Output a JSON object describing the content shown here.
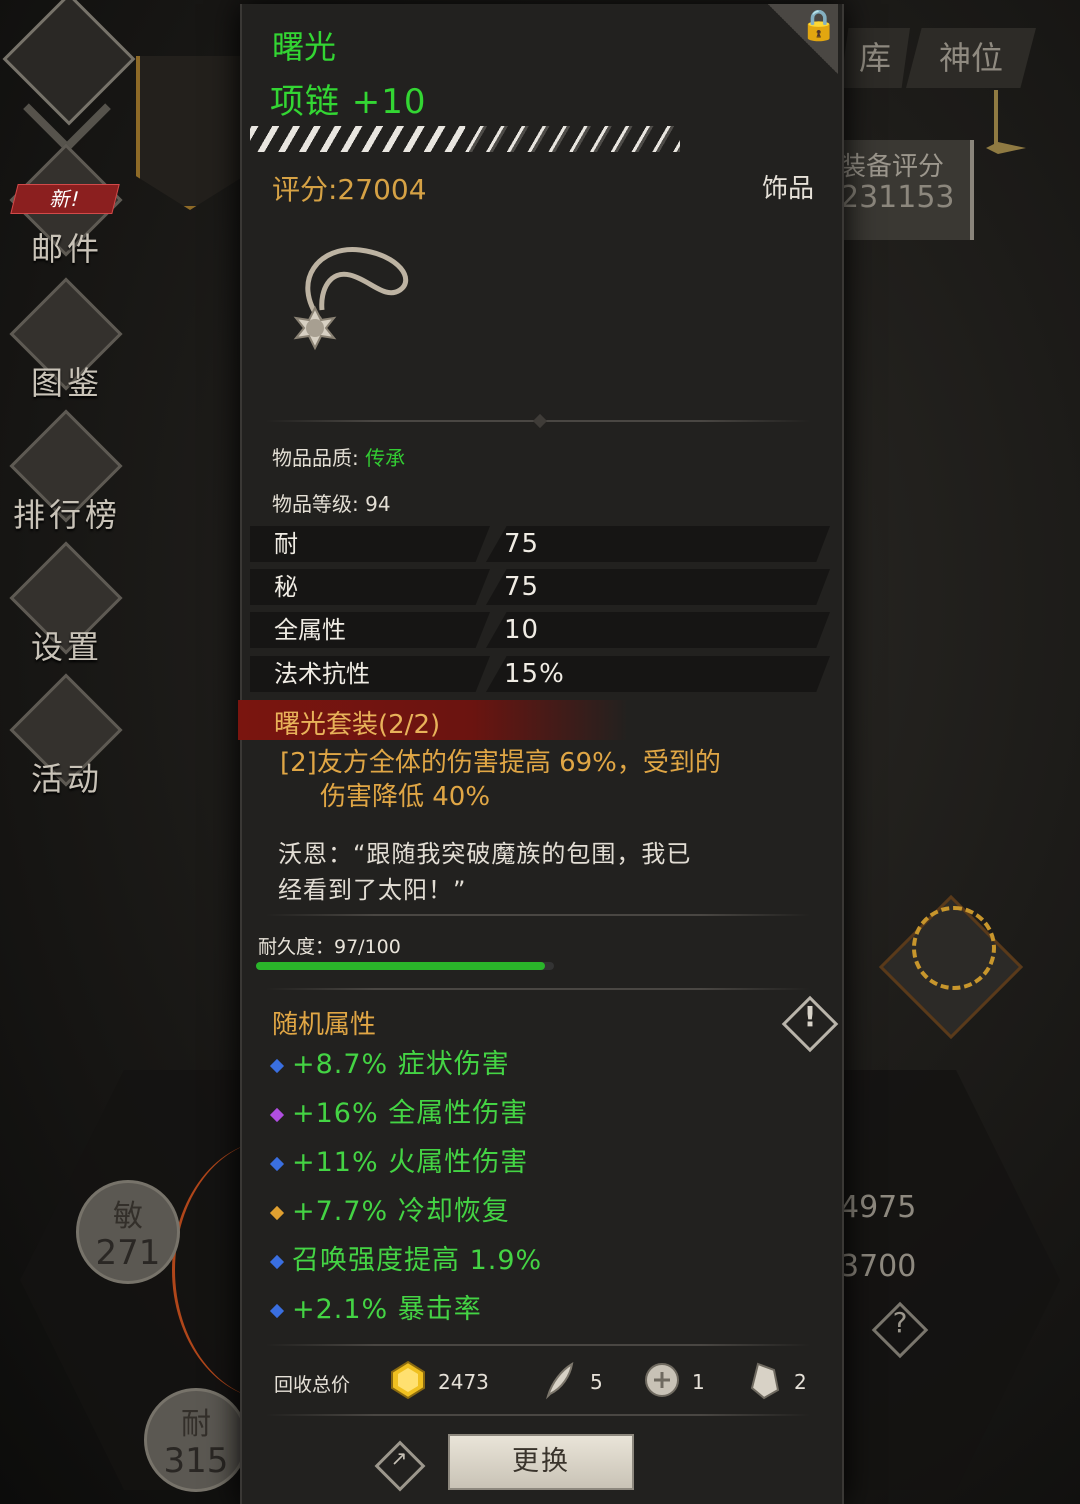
{
  "left_menu": {
    "new_badge": "新!",
    "items": [
      {
        "label": "邮件",
        "icon": "mail-icon"
      },
      {
        "label": "图鉴",
        "icon": "book-icon"
      },
      {
        "label": "排行榜",
        "icon": "ranking-icon"
      },
      {
        "label": "设置",
        "icon": "gear-icon"
      },
      {
        "label": "活动",
        "icon": "event-icon"
      }
    ]
  },
  "right": {
    "tabs": [
      "库",
      "神位"
    ],
    "score_title": "装备评分",
    "score_value": "231153",
    "stat_a": "4975",
    "stat_b": "3700",
    "help": "?"
  },
  "bottom_left": {
    "stats": [
      {
        "key": "敏",
        "value": "271"
      },
      {
        "key": "耐",
        "value": "315"
      }
    ]
  },
  "item": {
    "name": "曙光",
    "subtitle": "项链 +10",
    "enhance_progress": 0.5,
    "score": "评分:27004",
    "type": "饰品",
    "quality_label": "物品品质: ",
    "quality_value": "传承",
    "level_text": "物品等级: 94",
    "attributes": [
      {
        "key": "耐",
        "value": "75"
      },
      {
        "key": "秘",
        "value": "75"
      },
      {
        "key": "全属性",
        "value": "10"
      },
      {
        "key": "法术抗性",
        "value": "15%"
      }
    ],
    "set_title": "曙光套装(2/2)",
    "set_bonus_line1": "[2]友方全体的伤害提高 69%，受到的",
    "set_bonus_line2": "伤害降低 40%",
    "quote_line1": "沃恩：“跟随我突破魔族的包围，我已",
    "quote_line2": "经看到了太阳！”",
    "durability_text": "耐久度：97/100",
    "durability_fraction": 0.97,
    "random_title": "随机属性",
    "random_affixes": [
      {
        "text": "+8.7% 症状伤害",
        "gem_color": "#3a6fe0"
      },
      {
        "text": "+16% 全属性伤害",
        "gem_color": "#b04ee0"
      },
      {
        "text": "+11% 火属性伤害",
        "gem_color": "#3a6fe0"
      },
      {
        "text": "+7.7% 冷却恢复",
        "gem_color": "#e0a030"
      },
      {
        "text": "召唤强度提高 1.9%",
        "gem_color": "#3a6fe0"
      },
      {
        "text": "+2.1% 暴击率",
        "gem_color": "#3a6fe0"
      }
    ],
    "recycle_label": "回收总价",
    "recycle": [
      {
        "icon": "gold-gem-icon",
        "amount": "2473"
      },
      {
        "icon": "feather-icon",
        "amount": "5"
      },
      {
        "icon": "rune-stone-icon",
        "amount": "1"
      },
      {
        "icon": "crystal-shard-icon",
        "amount": "2"
      }
    ],
    "replace_button": "更换"
  },
  "colors": {
    "legendary_green": "#33d633",
    "gold_text": "#e0a645",
    "set_red": "#7a150f"
  }
}
